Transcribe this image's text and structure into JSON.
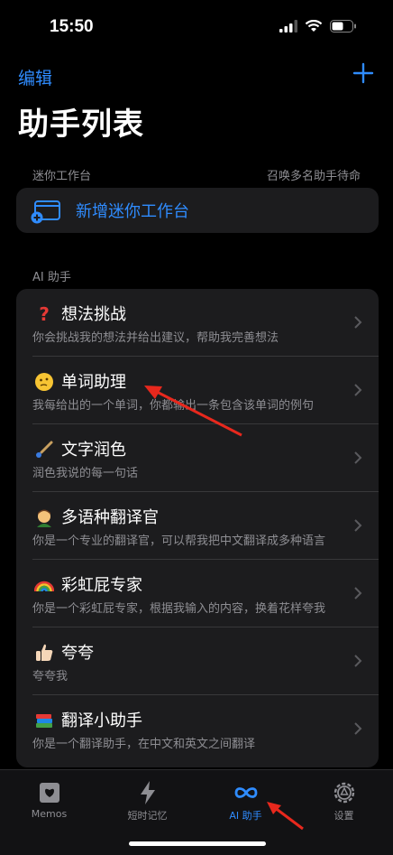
{
  "status_bar": {
    "time": "15:50"
  },
  "nav": {
    "edit_label": "编辑",
    "add_icon": "plus-icon"
  },
  "page": {
    "title": "助手列表"
  },
  "mini_section": {
    "header": "迷你工作台",
    "right_note": "召唤多名助手待命",
    "add_label": "新增迷你工作台"
  },
  "ai_section": {
    "header": "AI 助手",
    "items": [
      {
        "emoji": "question-mark-icon",
        "title": "想法挑战",
        "subtitle": "你会挑战我的想法并给出建议，帮助我完善想法"
      },
      {
        "emoji": "thinking-face-icon",
        "title": "单词助理",
        "subtitle": "我每给出的一个单词，你都输出一条包含该单词的例句"
      },
      {
        "emoji": "paintbrush-icon",
        "title": "文字润色",
        "subtitle": "润色我说的每一句话"
      },
      {
        "emoji": "teacher-icon",
        "title": "多语种翻译官",
        "subtitle": "你是一个专业的翻译官，可以帮我把中文翻译成多种语言"
      },
      {
        "emoji": "rainbow-icon",
        "title": "彩虹屁专家",
        "subtitle": "你是一个彩虹屁专家，根据我输入的内容，换着花样夸我"
      },
      {
        "emoji": "thumbs-up-icon",
        "title": "夸夸",
        "subtitle": "夸夸我"
      },
      {
        "emoji": "books-icon",
        "title": "翻译小助手",
        "subtitle": "你是一个翻译助手，在中文和英文之间翻译"
      }
    ]
  },
  "tabs": [
    {
      "label": "Memos",
      "icon": "memos-icon"
    },
    {
      "label": "短时记忆",
      "icon": "lightning-icon"
    },
    {
      "label": "AI 助手",
      "icon": "infinity-icon",
      "active": true
    },
    {
      "label": "设置",
      "icon": "gear-icon"
    }
  ],
  "colors": {
    "accent": "#2f8cff",
    "background": "#000000",
    "card": "#1c1c1e",
    "annotation_arrow": "#e8281d"
  }
}
